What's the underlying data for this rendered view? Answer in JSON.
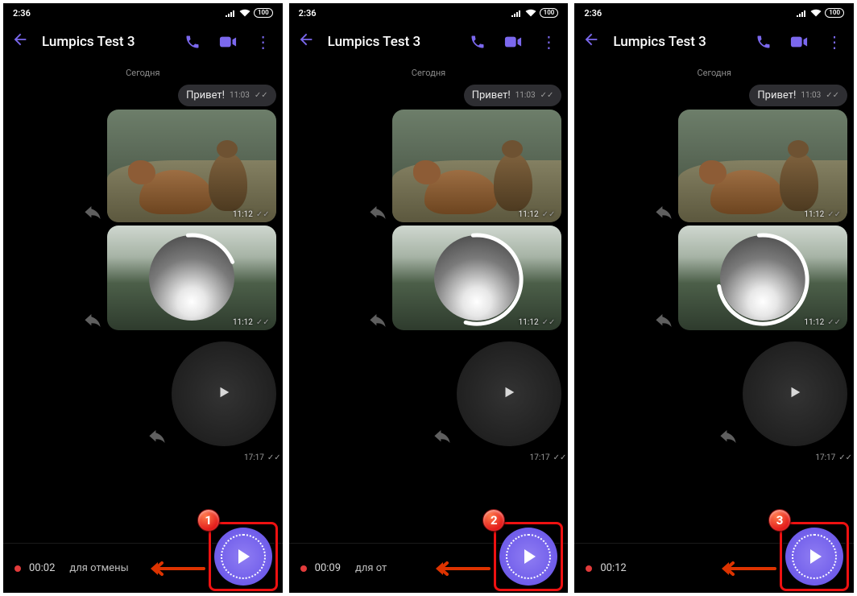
{
  "statusbar": {
    "time": "2:36",
    "battery": "100"
  },
  "appbar": {
    "title": "Lumpics Test 3"
  },
  "chat": {
    "day_label": "Сегодня",
    "greeting": {
      "text": "Привет!",
      "time": "11:03"
    },
    "image1_time": "11:12",
    "image2_time": "11:12",
    "video_time": "17:17"
  },
  "panes": [
    {
      "badge": "1",
      "rec_time": "00:02",
      "cancel_text": "для отмены",
      "arc_dash": "70 300",
      "arc_rotate": -95
    },
    {
      "badge": "2",
      "rec_time": "00:09",
      "cancel_text": "для от",
      "arc_dash": "195 300",
      "arc_rotate": -95
    },
    {
      "badge": "3",
      "rec_time": "00:12",
      "cancel_text": "",
      "arc_dash": "260 300",
      "arc_rotate": -95
    }
  ],
  "icons": {
    "back": "←",
    "call": "phone",
    "video": "videocam",
    "more": "⋮",
    "forward": "share",
    "play": "▶",
    "ticks": "✓✓"
  }
}
